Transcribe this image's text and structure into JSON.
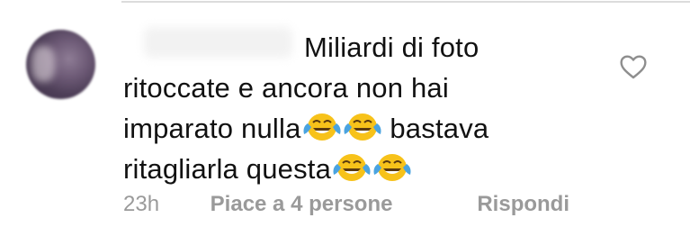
{
  "comment": {
    "username": "",
    "lines": [
      "Miliardi di foto",
      "ritoccate e ancora non hai",
      "imparato nulla",
      "bastava",
      "ritagliarla questa"
    ],
    "emoji_icon": "face-with-tears-of-joy-icon"
  },
  "meta": {
    "time": "23h",
    "likes_label": "Piace a 4 persone",
    "reply_label": "Rispondi"
  },
  "colors": {
    "text": "#111111",
    "meta": "#9a9a9a",
    "divider": "#dcdcdc",
    "heart_outline": "#8e8e8e",
    "emoji_face": "#f7c21a",
    "emoji_tears": "#4aa3e0"
  }
}
